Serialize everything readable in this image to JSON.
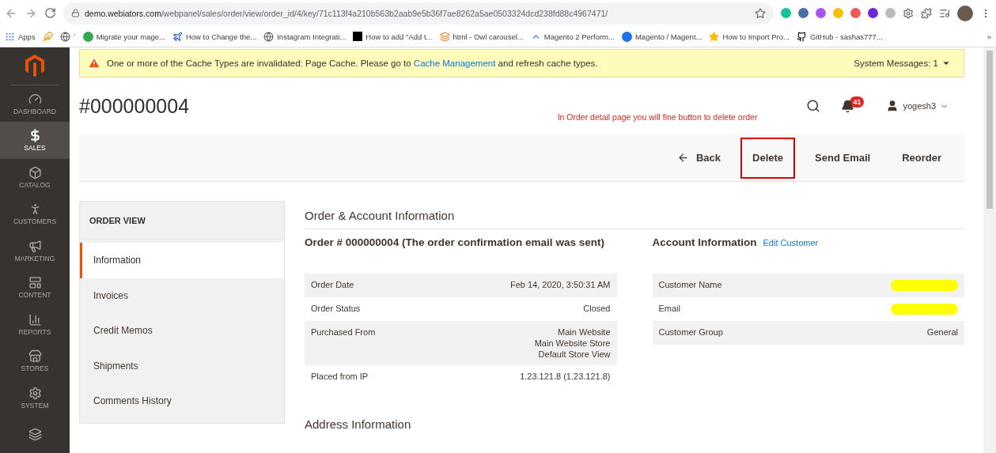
{
  "browser": {
    "url_host": "demo.webiators.com",
    "url_path": "/webpanel/sales/order/view/order_id/4/key/71c113f4a210b563b2aab9e5b36f7ae8262a5ae0503324dcd238fd88c4967471/",
    "bookmarks": [
      {
        "label": "Apps",
        "kind": "apps"
      },
      {
        "kind": "feather"
      },
      {
        "label": "`",
        "kind": "globe"
      },
      {
        "label": "Migrate your mage...",
        "kind": "green"
      },
      {
        "label": "How to Change the...",
        "kind": "plane"
      },
      {
        "label": "Instagram Integrati...",
        "kind": "globe"
      },
      {
        "label": "How to add \"Add t...",
        "kind": "m"
      },
      {
        "label": "html - Owl carousel...",
        "kind": "stack"
      },
      {
        "label": "Magento 2 Perform...",
        "kind": "chevron"
      },
      {
        "label": "Magento / Magent...",
        "kind": "hex"
      },
      {
        "label": "How to Import Pro...",
        "kind": "star"
      },
      {
        "label": "GitHub - sashas777...",
        "kind": "github"
      }
    ],
    "more": "»"
  },
  "nav": [
    {
      "label": "DASHBOARD",
      "kind": "dashboard",
      "selected": false
    },
    {
      "label": "SALES",
      "kind": "sales",
      "selected": true
    },
    {
      "label": "CATALOG",
      "kind": "catalog",
      "selected": false
    },
    {
      "label": "CUSTOMERS",
      "kind": "customers",
      "selected": false
    },
    {
      "label": "MARKETING",
      "kind": "marketing",
      "selected": false
    },
    {
      "label": "CONTENT",
      "kind": "content",
      "selected": false
    },
    {
      "label": "REPORTS",
      "kind": "reports",
      "selected": false
    },
    {
      "label": "STORES",
      "kind": "stores",
      "selected": false
    },
    {
      "label": "SYSTEM",
      "kind": "system",
      "selected": false
    }
  ],
  "message": {
    "before": "One or more of the Cache Types are invalidated: Page Cache. Please go to ",
    "link": "Cache Management",
    "after": " and refresh cache types.",
    "system_messages": "System Messages: 1"
  },
  "header": {
    "title": "#000000004",
    "annotation": "In Order detail page you will fine button to delete order",
    "notifications": "41",
    "user": "yogesh3"
  },
  "actions": [
    {
      "label": "Back",
      "kind": "back",
      "highlighted": false
    },
    {
      "label": "Delete",
      "kind": "plain",
      "highlighted": true
    },
    {
      "label": "Send Email",
      "kind": "plain",
      "highlighted": false
    },
    {
      "label": "Reorder",
      "kind": "plain",
      "highlighted": false
    }
  ],
  "order_view": {
    "title": "ORDER VIEW",
    "tabs": [
      {
        "label": "Information",
        "selected": true
      },
      {
        "label": "Invoices",
        "selected": false
      },
      {
        "label": "Credit Memos",
        "selected": false
      },
      {
        "label": "Shipments",
        "selected": false
      },
      {
        "label": "Comments History",
        "selected": false
      }
    ]
  },
  "section_title": "Order & Account Information",
  "order": {
    "title": "Order # 000000004 (The order confirmation email was sent)",
    "rows": [
      {
        "label": "Order Date",
        "value": [
          "Feb 14, 2020, 3:50:31 AM"
        ]
      },
      {
        "label": "Order Status",
        "value": [
          "Closed"
        ]
      },
      {
        "label": "Purchased From",
        "value": [
          "Main Website",
          "Main Website Store",
          "Default Store View"
        ]
      },
      {
        "label": "Placed from IP",
        "value": [
          "1.23.121.8 (1.23.121.8)"
        ]
      }
    ]
  },
  "account": {
    "title": "Account Information",
    "link": "Edit Customer",
    "rows": [
      {
        "label": "Customer Name",
        "redacted": true
      },
      {
        "label": "Email",
        "redacted": true
      },
      {
        "label": "Customer Group",
        "value": "General",
        "redacted": false
      }
    ]
  },
  "address_title": "Address Information"
}
